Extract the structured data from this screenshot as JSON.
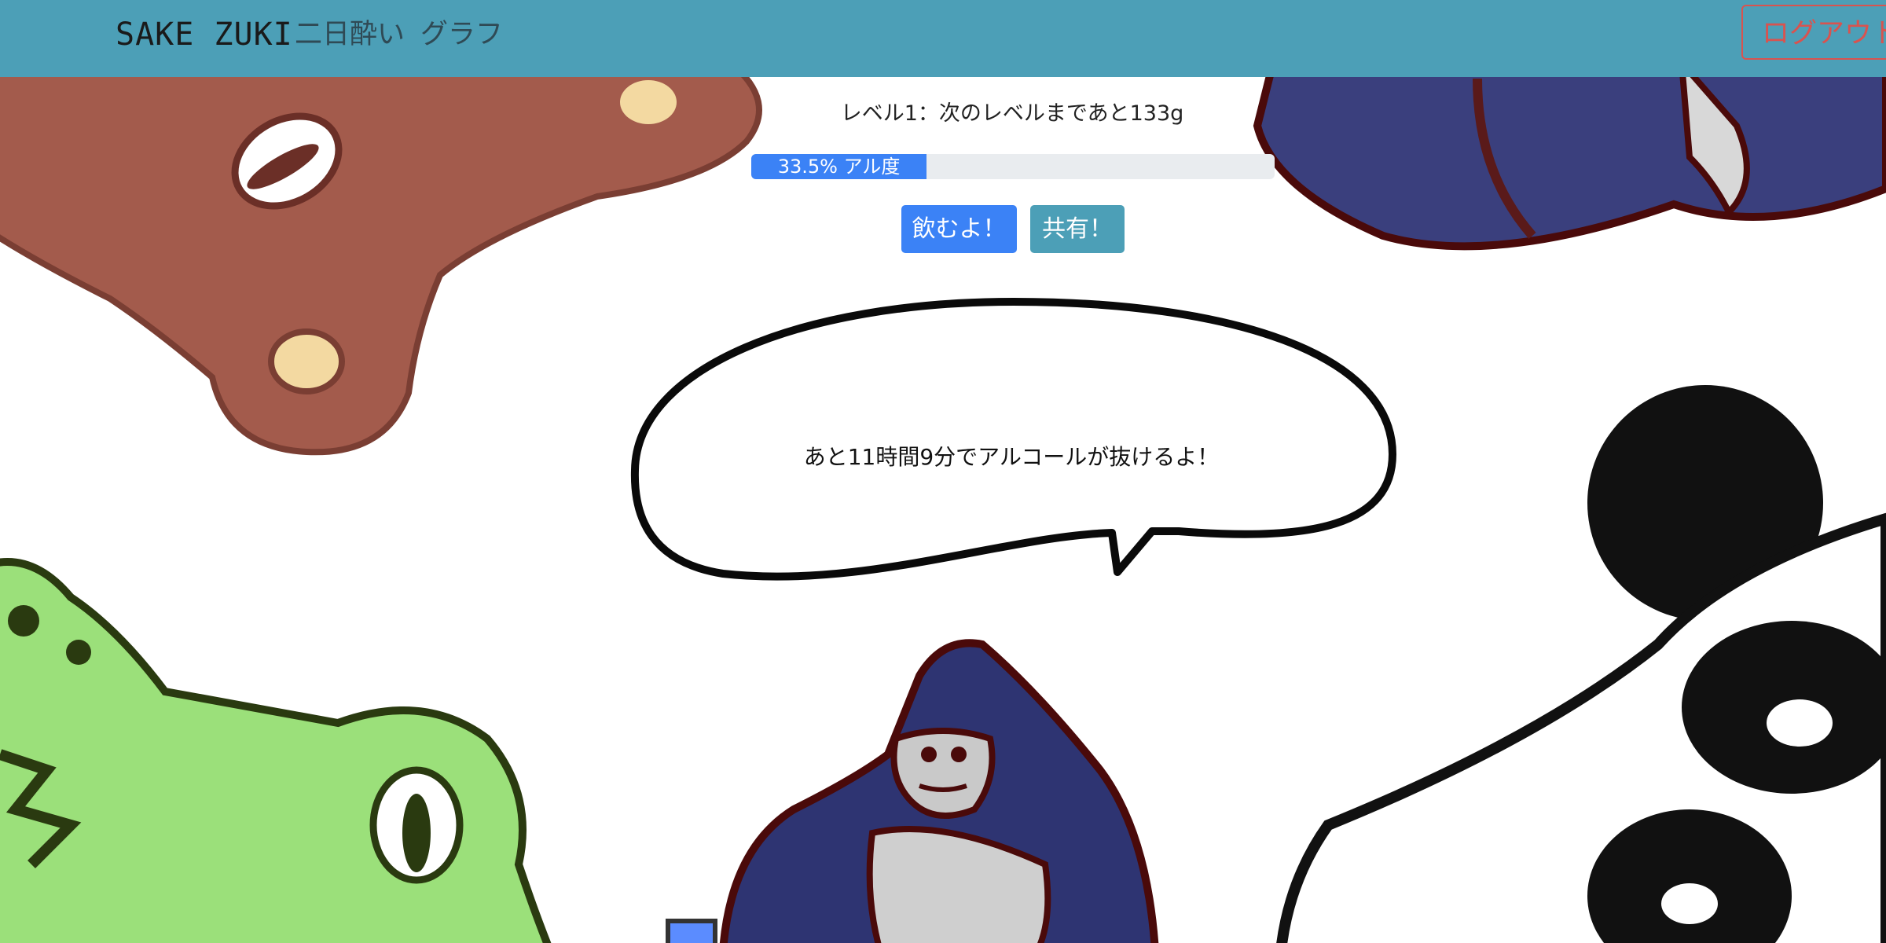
{
  "navbar": {
    "brand": "SAKE ZUKI",
    "links": [
      "二日酔い",
      "グラフ"
    ],
    "logout_label": "ログアウト",
    "background_color": "#4c9fb7"
  },
  "status": {
    "level_text": "レベル1：次のレベルまであと133g",
    "progress_percent": 33.5,
    "progress_label": "33.5% アル度"
  },
  "actions": {
    "drink_label": "飲むよ！",
    "share_label": "共有！"
  },
  "speech_bubble": {
    "text": "あと11時間9分でアルコールが抜けるよ！"
  },
  "illustrations": [
    "bear",
    "blue-animal",
    "frog",
    "gorilla",
    "panda"
  ],
  "colors": {
    "primary": "#3b82f6",
    "info": "#4c9fb7",
    "danger": "#d9534f"
  }
}
